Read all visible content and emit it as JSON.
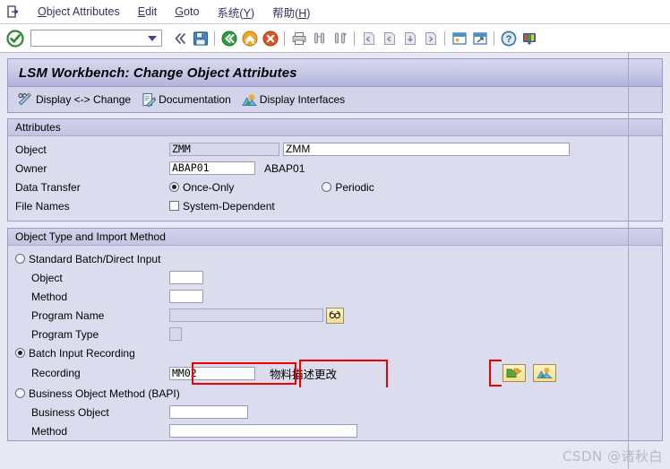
{
  "menubar": {
    "system_icon": "document-exit-icon",
    "items": [
      {
        "label": "Object Attributes",
        "accel": "O",
        "name": "menu-object-attributes"
      },
      {
        "label": "Edit",
        "accel": "E",
        "name": "menu-edit"
      },
      {
        "label": "Goto",
        "accel": "G",
        "name": "menu-goto"
      },
      {
        "label": "系统(Y)",
        "accel": "Y",
        "name": "menu-system"
      },
      {
        "label": "帮助(H)",
        "accel": "H",
        "name": "menu-help"
      }
    ]
  },
  "toolbar": {
    "ok_icon": "green-check-icon",
    "command_value": "",
    "command_placeholder": "",
    "icons": [
      "back-chevrons-icon",
      "save-icon",
      "back-green-icon",
      "exit-yellow-icon",
      "cancel-red-icon",
      "print-icon",
      "find-icon",
      "find-next-icon",
      "first-page-icon",
      "previous-page-icon",
      "next-page-icon",
      "last-page-icon",
      "create-session-icon",
      "create-shortcut-icon",
      "help-icon",
      "customize-layout-icon"
    ]
  },
  "window": {
    "title": "LSM Workbench: Change Object Attributes"
  },
  "function_bar": {
    "buttons": [
      {
        "label": "Display <-> Change",
        "icon": "glasses-pencil-icon",
        "name": "display-change-button"
      },
      {
        "label": "Documentation",
        "icon": "document-pencil-icon",
        "name": "documentation-button"
      },
      {
        "label": "Display Interfaces",
        "icon": "mountain-sun-icon",
        "name": "display-interfaces-button"
      }
    ]
  },
  "attributes": {
    "header": "Attributes",
    "object_label": "Object",
    "object_value": "ZMM",
    "object_desc_value": "ZMM",
    "owner_label": "Owner",
    "owner_value": "ABAP01",
    "owner_static": "ABAP01",
    "data_transfer_label": "Data Transfer",
    "once_only_label": "Once-Only",
    "once_only_selected": true,
    "periodic_label": "Periodic",
    "periodic_selected": false,
    "file_names_label": "File Names",
    "system_dependent_label": "System-Dependent",
    "system_dependent_checked": false
  },
  "object_type": {
    "header": "Object Type and Import Method",
    "standard_batch_label": "Standard Batch/Direct Input",
    "standard_batch_selected": false,
    "object_label": "Object",
    "object_value": "",
    "method_label": "Method",
    "method_value": "",
    "program_name_label": "Program Name",
    "program_name_value": "",
    "program_name_button_icon": "glasses-icon",
    "program_type_label": "Program Type",
    "program_type_value": "",
    "batch_input_recording_label": "Batch Input Recording",
    "batch_input_recording_selected": true,
    "recording_label": "Recording",
    "recording_value": "MM02",
    "recording_annotation": "物料描述更改",
    "recording_button1_icon": "folder-arrow-icon",
    "recording_button2_icon": "mountain-sun-icon",
    "bapi_label": "Business Object Method  (BAPI)",
    "bapi_selected": false,
    "business_object_label": "Business Object",
    "business_object_value": "",
    "bapi_method_label": "Method",
    "bapi_method_value": ""
  },
  "watermark": {
    "text": "CSDN @诸秋白"
  },
  "colors": {
    "accent": "#b3b3dc",
    "panel": "#dcdcef",
    "app_bg": "#e8e8f4",
    "highlight_red": "#ee0000",
    "button_yellow": "#f5e08e"
  }
}
